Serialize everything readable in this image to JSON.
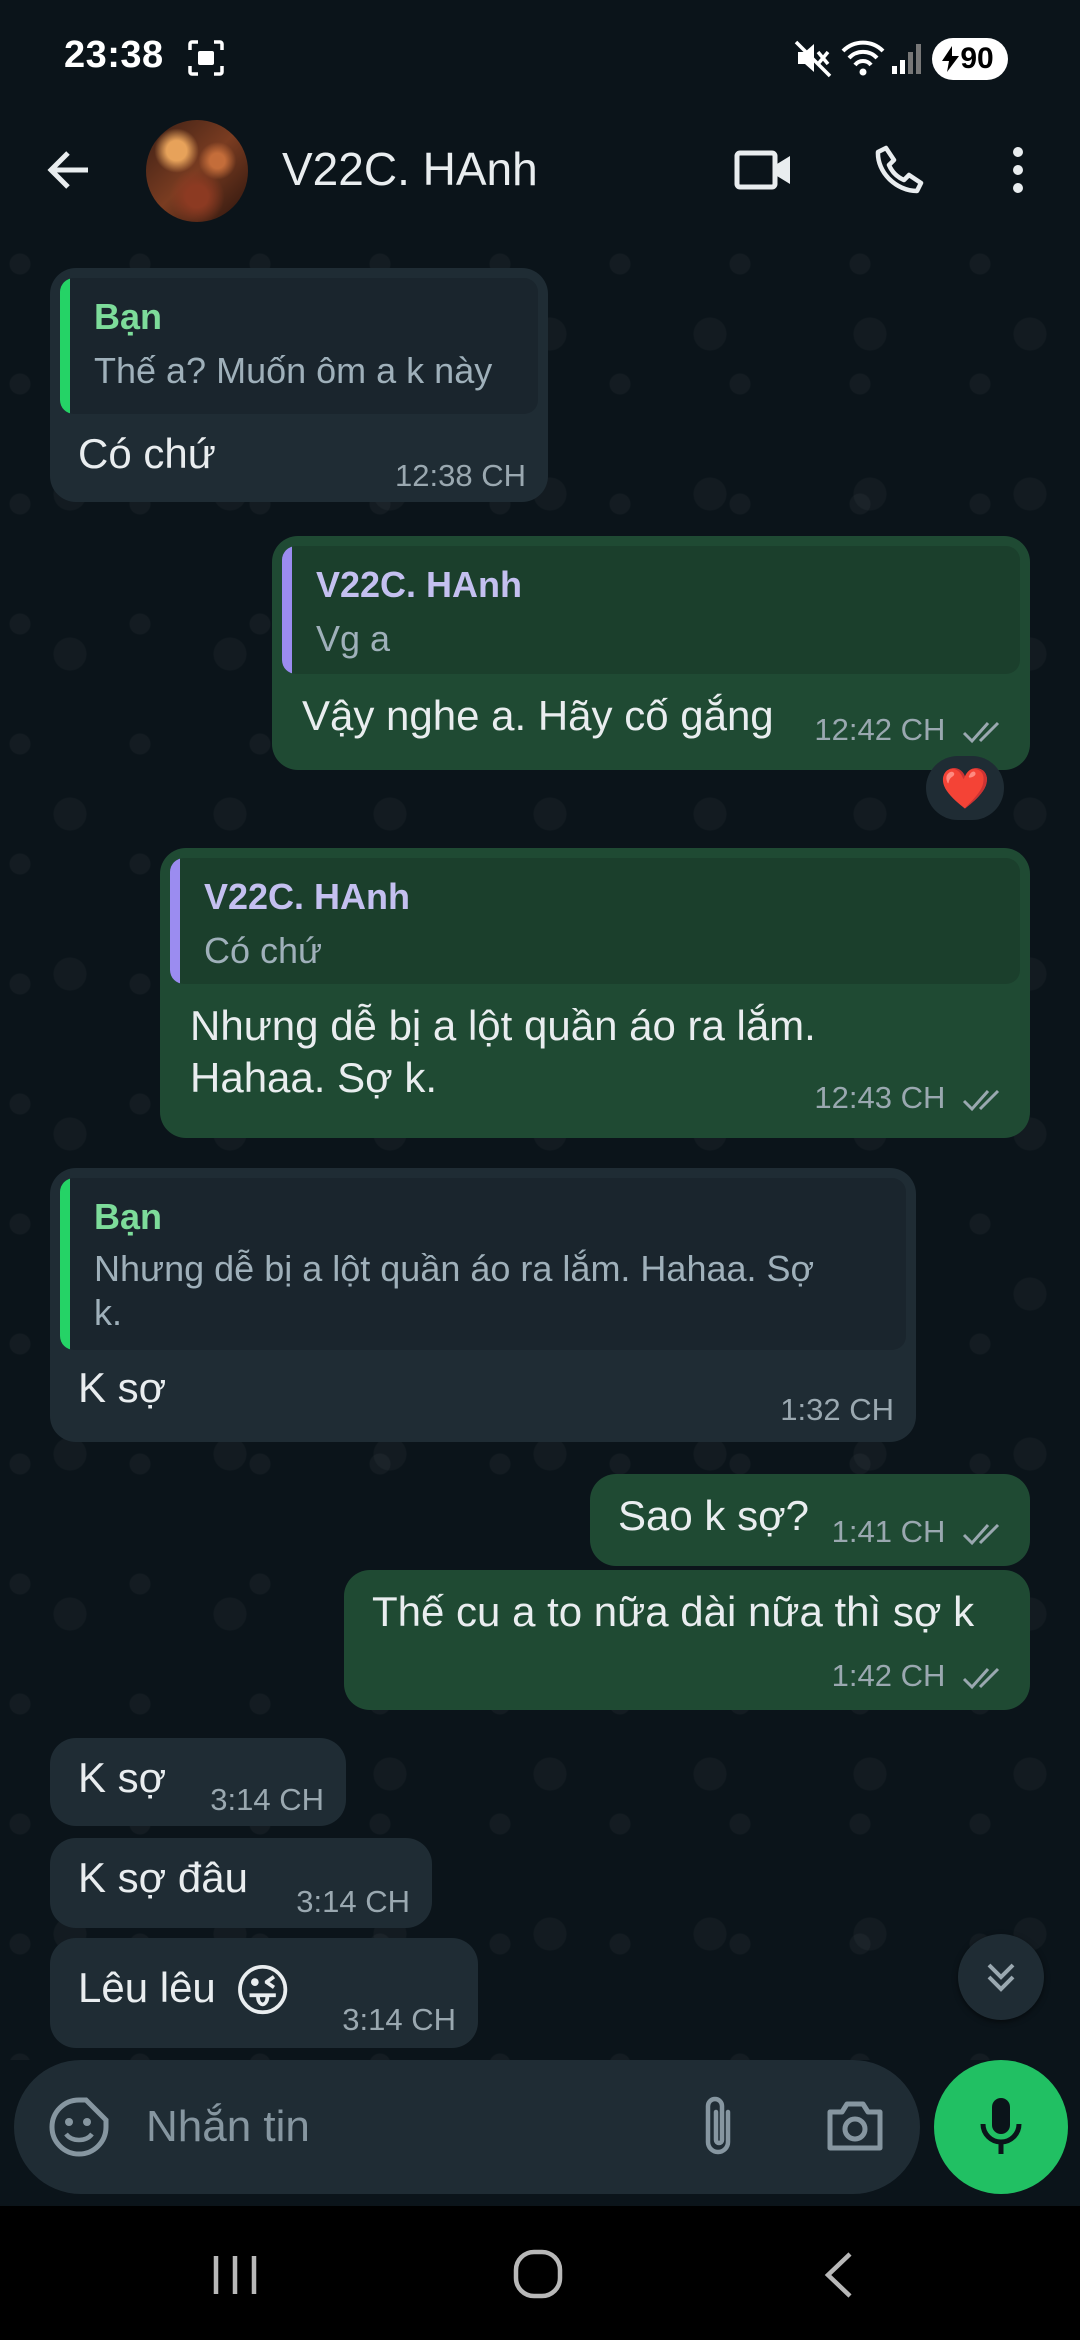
{
  "status_bar": {
    "time": "23:38",
    "battery": "90",
    "icons": [
      "screen-record-icon",
      "mute-icon",
      "wifi-icon",
      "signal-icon",
      "battery-icon"
    ]
  },
  "header": {
    "contact_name": "V22C. HAnh",
    "icons": [
      "back-arrow-icon",
      "video-call-icon",
      "phone-icon",
      "more-options-icon"
    ]
  },
  "messages": [
    {
      "direction": "in",
      "quote_name": "Bạn",
      "quote_text": "Thế a? Muốn ôm a k này",
      "text": "Có chứ",
      "time": "12:38 CH"
    },
    {
      "direction": "out",
      "quote_name": "V22C. HAnh",
      "quote_text": "Vg a",
      "text": "Vậy nghe a. Hãy cố gắng",
      "time": "12:42 CH",
      "reaction": "❤️"
    },
    {
      "direction": "out",
      "quote_name": "V22C. HAnh",
      "quote_text": "Có chứ",
      "text_line1": "Nhưng dễ bị a lột quần áo ra lắm.",
      "text_line2": "Hahaa. Sợ k.",
      "time": "12:43 CH"
    },
    {
      "direction": "in",
      "quote_name": "Bạn",
      "quote_line1": "Nhưng dễ bị a lột quần áo ra lắm. Hahaa. Sợ",
      "quote_line2": "k.",
      "text": "K sợ",
      "time": "1:32 CH"
    },
    {
      "direction": "out",
      "text": "Sao k sợ?",
      "time": "1:41 CH"
    },
    {
      "direction": "out",
      "text": "Thế cu a to nữa dài nữa thì sợ k",
      "time": "1:42 CH"
    },
    {
      "direction": "in",
      "text": "K sợ",
      "time": "3:14 CH"
    },
    {
      "direction": "in",
      "text": "K sợ đâu",
      "time": "3:14 CH"
    },
    {
      "direction": "in",
      "text": "Lêu lêu",
      "emoji": "😜",
      "time": "3:14 CH"
    }
  ],
  "composer": {
    "placeholder": "Nhắn tin",
    "icons": [
      "emoji-sticker-icon",
      "attach-icon",
      "camera-icon",
      "mic-icon"
    ]
  },
  "colors": {
    "background": "#0b141a",
    "incoming_bubble": "#1f2c34",
    "outgoing_bubble": "#1f4a33",
    "accent_green": "#21c063",
    "quote_self_name": "#7ddc9a",
    "quote_contact_name": "#c4c0f0",
    "quote_bar_green": "#25d366",
    "quote_bar_purple": "#9b8cf0"
  },
  "nav_bar": {
    "icons": [
      "recent-apps-icon",
      "home-icon",
      "back-icon"
    ]
  }
}
